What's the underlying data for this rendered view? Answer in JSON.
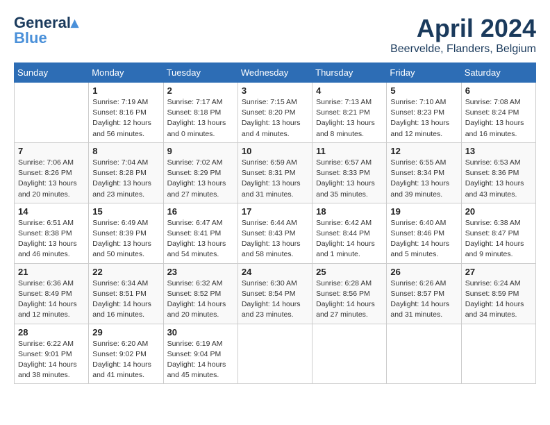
{
  "header": {
    "logo_line1": "General",
    "logo_line2": "Blue",
    "month": "April 2024",
    "location": "Beervelde, Flanders, Belgium"
  },
  "weekdays": [
    "Sunday",
    "Monday",
    "Tuesday",
    "Wednesday",
    "Thursday",
    "Friday",
    "Saturday"
  ],
  "weeks": [
    [
      {
        "day": "",
        "info": ""
      },
      {
        "day": "1",
        "info": "Sunrise: 7:19 AM\nSunset: 8:16 PM\nDaylight: 12 hours\nand 56 minutes."
      },
      {
        "day": "2",
        "info": "Sunrise: 7:17 AM\nSunset: 8:18 PM\nDaylight: 13 hours\nand 0 minutes."
      },
      {
        "day": "3",
        "info": "Sunrise: 7:15 AM\nSunset: 8:20 PM\nDaylight: 13 hours\nand 4 minutes."
      },
      {
        "day": "4",
        "info": "Sunrise: 7:13 AM\nSunset: 8:21 PM\nDaylight: 13 hours\nand 8 minutes."
      },
      {
        "day": "5",
        "info": "Sunrise: 7:10 AM\nSunset: 8:23 PM\nDaylight: 13 hours\nand 12 minutes."
      },
      {
        "day": "6",
        "info": "Sunrise: 7:08 AM\nSunset: 8:24 PM\nDaylight: 13 hours\nand 16 minutes."
      }
    ],
    [
      {
        "day": "7",
        "info": "Sunrise: 7:06 AM\nSunset: 8:26 PM\nDaylight: 13 hours\nand 20 minutes."
      },
      {
        "day": "8",
        "info": "Sunrise: 7:04 AM\nSunset: 8:28 PM\nDaylight: 13 hours\nand 23 minutes."
      },
      {
        "day": "9",
        "info": "Sunrise: 7:02 AM\nSunset: 8:29 PM\nDaylight: 13 hours\nand 27 minutes."
      },
      {
        "day": "10",
        "info": "Sunrise: 6:59 AM\nSunset: 8:31 PM\nDaylight: 13 hours\nand 31 minutes."
      },
      {
        "day": "11",
        "info": "Sunrise: 6:57 AM\nSunset: 8:33 PM\nDaylight: 13 hours\nand 35 minutes."
      },
      {
        "day": "12",
        "info": "Sunrise: 6:55 AM\nSunset: 8:34 PM\nDaylight: 13 hours\nand 39 minutes."
      },
      {
        "day": "13",
        "info": "Sunrise: 6:53 AM\nSunset: 8:36 PM\nDaylight: 13 hours\nand 43 minutes."
      }
    ],
    [
      {
        "day": "14",
        "info": "Sunrise: 6:51 AM\nSunset: 8:38 PM\nDaylight: 13 hours\nand 46 minutes."
      },
      {
        "day": "15",
        "info": "Sunrise: 6:49 AM\nSunset: 8:39 PM\nDaylight: 13 hours\nand 50 minutes."
      },
      {
        "day": "16",
        "info": "Sunrise: 6:47 AM\nSunset: 8:41 PM\nDaylight: 13 hours\nand 54 minutes."
      },
      {
        "day": "17",
        "info": "Sunrise: 6:44 AM\nSunset: 8:43 PM\nDaylight: 13 hours\nand 58 minutes."
      },
      {
        "day": "18",
        "info": "Sunrise: 6:42 AM\nSunset: 8:44 PM\nDaylight: 14 hours\nand 1 minute."
      },
      {
        "day": "19",
        "info": "Sunrise: 6:40 AM\nSunset: 8:46 PM\nDaylight: 14 hours\nand 5 minutes."
      },
      {
        "day": "20",
        "info": "Sunrise: 6:38 AM\nSunset: 8:47 PM\nDaylight: 14 hours\nand 9 minutes."
      }
    ],
    [
      {
        "day": "21",
        "info": "Sunrise: 6:36 AM\nSunset: 8:49 PM\nDaylight: 14 hours\nand 12 minutes."
      },
      {
        "day": "22",
        "info": "Sunrise: 6:34 AM\nSunset: 8:51 PM\nDaylight: 14 hours\nand 16 minutes."
      },
      {
        "day": "23",
        "info": "Sunrise: 6:32 AM\nSunset: 8:52 PM\nDaylight: 14 hours\nand 20 minutes."
      },
      {
        "day": "24",
        "info": "Sunrise: 6:30 AM\nSunset: 8:54 PM\nDaylight: 14 hours\nand 23 minutes."
      },
      {
        "day": "25",
        "info": "Sunrise: 6:28 AM\nSunset: 8:56 PM\nDaylight: 14 hours\nand 27 minutes."
      },
      {
        "day": "26",
        "info": "Sunrise: 6:26 AM\nSunset: 8:57 PM\nDaylight: 14 hours\nand 31 minutes."
      },
      {
        "day": "27",
        "info": "Sunrise: 6:24 AM\nSunset: 8:59 PM\nDaylight: 14 hours\nand 34 minutes."
      }
    ],
    [
      {
        "day": "28",
        "info": "Sunrise: 6:22 AM\nSunset: 9:01 PM\nDaylight: 14 hours\nand 38 minutes."
      },
      {
        "day": "29",
        "info": "Sunrise: 6:20 AM\nSunset: 9:02 PM\nDaylight: 14 hours\nand 41 minutes."
      },
      {
        "day": "30",
        "info": "Sunrise: 6:19 AM\nSunset: 9:04 PM\nDaylight: 14 hours\nand 45 minutes."
      },
      {
        "day": "",
        "info": ""
      },
      {
        "day": "",
        "info": ""
      },
      {
        "day": "",
        "info": ""
      },
      {
        "day": "",
        "info": ""
      }
    ]
  ]
}
